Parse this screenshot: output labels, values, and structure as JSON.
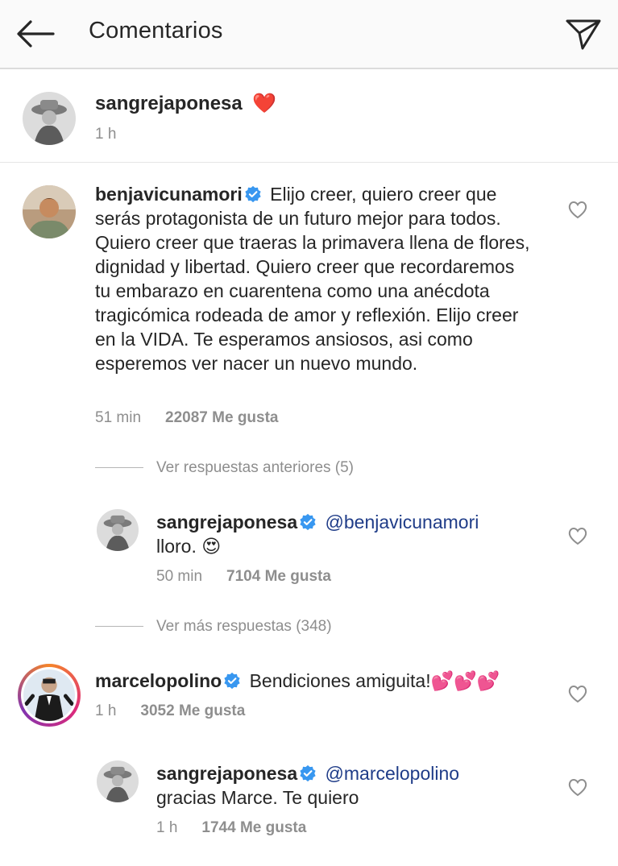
{
  "header": {
    "title": "Comentarios"
  },
  "caption": {
    "username": "sangrejaponesa",
    "emoji": "❤️",
    "time": "1 h"
  },
  "comments": [
    {
      "username": "benjavicunamori",
      "verified": true,
      "text": "Elijo creer, quiero creer que serás protagonista de un futuro mejor para todos. Quiero creer que traeras la primavera llena de flores, dignidad y libertad. Quiero creer que recordaremos tu embarazo en cuarentena como una anécdota tragicómica rodeada de amor y reflexión. Elijo creer en la VIDA. Te esperamos ansiosos, asi como esperemos ver nacer un nuevo mundo.",
      "time": "51 min",
      "likes": "22087 Me gusta",
      "view_previous": "Ver respuestas anteriores (5)",
      "reply": {
        "username": "sangrejaponesa",
        "mention": "@benjavicunamori",
        "text": "lloro. 😍",
        "time": "50 min",
        "likes": "7104 Me gusta"
      },
      "view_more": "Ver más respuestas (348)"
    },
    {
      "username": "marcelopolino",
      "verified": true,
      "text": "Bendiciones amiguita!💕💕💕",
      "time": "1 h",
      "likes": "3052 Me gusta",
      "reply": {
        "username": "sangrejaponesa",
        "mention": "@marcelopolino",
        "text": "gracias Marce. Te quiero",
        "time": "1 h",
        "likes": "1744 Me gusta"
      }
    }
  ],
  "colors": {
    "verified": "#3897f0",
    "mention": "#1f3c88",
    "meta": "#8e8e8e",
    "heart": "#ed2c3c"
  },
  "icons": {
    "back": "arrow-left-icon",
    "send": "paper-plane-icon",
    "like": "heart-outline-icon",
    "verified": "verified-badge-icon"
  }
}
